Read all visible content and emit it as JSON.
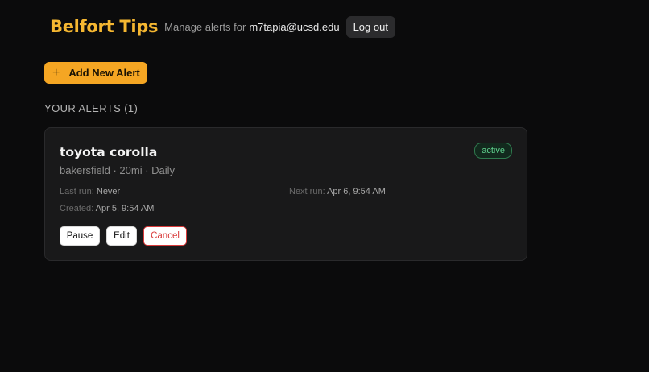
{
  "header": {
    "brand": "Belfort Tips",
    "manage_label": "Manage alerts for",
    "email": "m7tapia@ucsd.edu",
    "logout_label": "Log out"
  },
  "actions": {
    "add_icon": "plus-icon",
    "add_label": "Add New Alert"
  },
  "alerts_section": {
    "title": "YOUR ALERTS (1)"
  },
  "alerts": [
    {
      "title": "toyota corolla",
      "subtitle": "bakersfield · 20mi · Daily",
      "status": "active",
      "last_run_label": "Last run:",
      "last_run": "Never",
      "next_run_label": "Next run:",
      "next_run": "Apr 6, 9:54 AM",
      "created_label": "Created:",
      "created": "Apr 5, 9:54 AM",
      "pause_label": "Pause",
      "edit_label": "Edit",
      "cancel_label": "Cancel"
    }
  ],
  "colors": {
    "background": "#0b0b0c",
    "brand": "#f5b731",
    "accent": "#f5a623",
    "status_active": "#5fd08d",
    "danger": "#d93a3a"
  }
}
